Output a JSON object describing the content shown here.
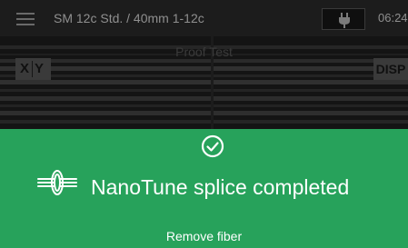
{
  "status_bar": {
    "title": "SM 12c Std. / 40mm 1-12c",
    "time": "06:24",
    "menu_icon": "hamburger-menu-icon",
    "power_icon": "plug-icon"
  },
  "viewer": {
    "label": "Proof Test",
    "xy_button": {
      "x": "X",
      "y": "Y"
    },
    "disp_button": "DISP"
  },
  "banner": {
    "background_color": "#27a25b",
    "status_icon": "check-circle-icon",
    "splice_icon": "nanotune-splice-icon",
    "message": "NanoTune splice completed",
    "instruction": "Remove fiber"
  }
}
